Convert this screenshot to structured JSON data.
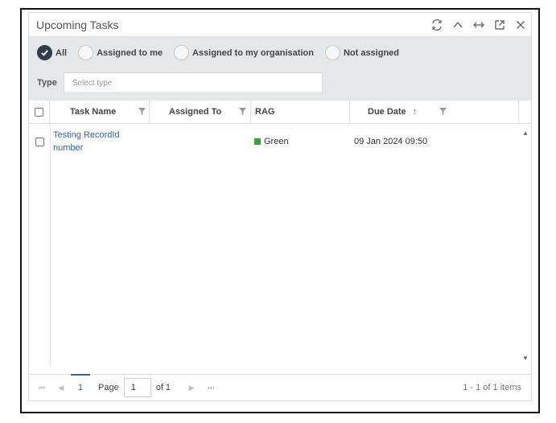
{
  "widget": {
    "title": "Upcoming Tasks",
    "tools": [
      "refresh-icon",
      "collapse-icon",
      "expand-width-icon",
      "popout-icon",
      "close-icon"
    ]
  },
  "filters": {
    "radios": [
      {
        "label": "All",
        "checked": true
      },
      {
        "label": "Assigned to me",
        "checked": false
      },
      {
        "label": "Assigned to my organisation",
        "checked": false
      },
      {
        "label": "Not assigned",
        "checked": false
      }
    ],
    "type_label": "Type",
    "type_placeholder": "Select type"
  },
  "grid": {
    "columns": {
      "task_name": "Task Name",
      "assigned_to": "Assigned To",
      "rag": "RAG",
      "due_date": "Due Date",
      "due_date_sort": "↑"
    },
    "rows": [
      {
        "task_name_line1": "Testing RecordId",
        "task_name_line2": "number",
        "assigned_to": "",
        "rag": "Green",
        "rag_color": "#3aa53a",
        "due_date": "09 Jan 2024 09:50"
      }
    ]
  },
  "pager": {
    "current_page": "1",
    "page_label": "Page",
    "page_value": "1",
    "of_label": "of 1",
    "info": "1 - 1 of 1 items"
  },
  "colors": {
    "accent": "#3465a4",
    "filter_bg": "#e6e7e9",
    "checked_radio": "#2f3e4f"
  }
}
